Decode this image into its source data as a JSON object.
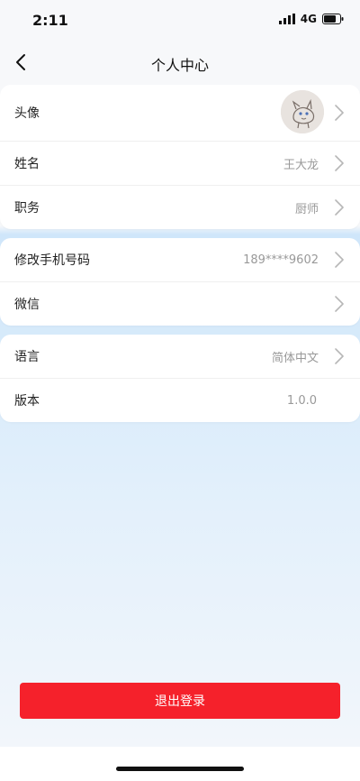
{
  "status_bar": {
    "time": "2:11",
    "network": "4G"
  },
  "header": {
    "title": "个人中心"
  },
  "profile": {
    "rows": [
      {
        "label": "头像"
      },
      {
        "label": "姓名",
        "value": "王大龙"
      },
      {
        "label": "职务",
        "value": "厨师"
      }
    ]
  },
  "contact": {
    "rows": [
      {
        "label": "修改手机号码",
        "value": "189****9602"
      },
      {
        "label": "微信",
        "value": ""
      }
    ]
  },
  "settings": {
    "rows": [
      {
        "label": "语言",
        "value": "简体中文"
      },
      {
        "label": "版本",
        "value": "1.0.0"
      }
    ]
  },
  "footer": {
    "logout_label": "退出登录"
  },
  "colors": {
    "accent_red": "#f5212b",
    "text_secondary": "#999999"
  },
  "icons": {
    "back": "chevron-left-icon",
    "row_arrow": "chevron-right-icon",
    "avatar": "avatar-image"
  }
}
